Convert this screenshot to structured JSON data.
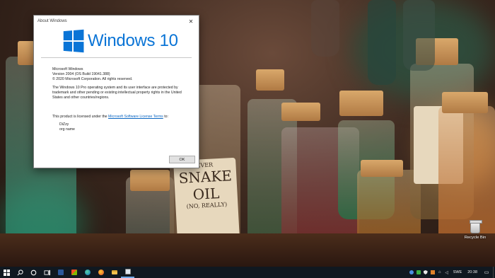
{
  "dialog": {
    "title": "About Windows",
    "close_glyph": "✕",
    "brand": "Windows 10",
    "product": "Microsoft Windows",
    "version": "Version 2004 (OS Build 19041.388)",
    "copyright": "© 2020 Microsoft Corporation. All rights reserved.",
    "legal": "The Windows 10 Pro operating system and its user interface are protected by trademark and other pending or existing intellectual property rights in the United States and other countries/regions.",
    "license_prefix": "This product is licensed under the ",
    "license_link": "Microsoft Software License Terms",
    "license_suffix": " to:",
    "licensed_user": "DiZzy",
    "licensed_org": "org name",
    "ok_label": "OK"
  },
  "wallpaper": {
    "snake_label_1": "SNAKE",
    "snake_label_2": "OIL",
    "snake_label_3": "(NO, REALLY)",
    "ever_label": "EVER"
  },
  "desktop": {
    "recycle_bin_label": "Recycle Bin"
  },
  "taskbar": {
    "icons": [
      "windows-start-icon",
      "search-icon",
      "cortana-icon",
      "task-view-icon",
      "word-icon",
      "store-icon",
      "edge-icon",
      "firefox-icon",
      "file-explorer-icon",
      "app-icon"
    ],
    "language": "SWE",
    "time": "20:38",
    "accent": "#0a74d6"
  }
}
